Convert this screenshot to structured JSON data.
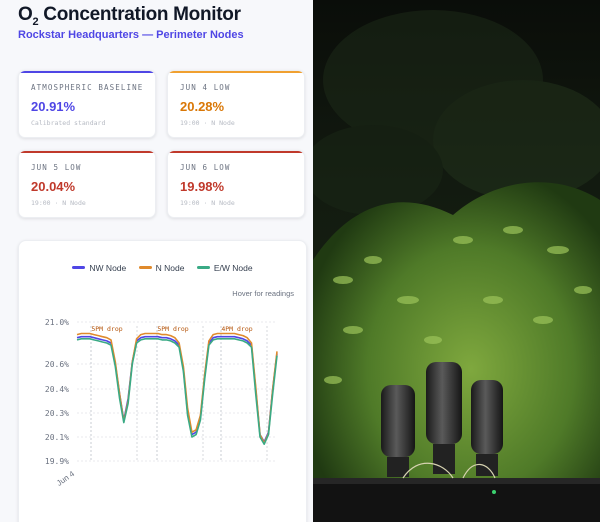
{
  "header": {
    "title_prefix": "O",
    "title_sub": "2",
    "title_rest": "Concentration Monitor",
    "subtitle": "Rockstar Headquarters — Perimeter Nodes"
  },
  "cards": [
    {
      "label": "ATMOSPHERIC BASELINE",
      "value": "20.91%",
      "note": "Calibrated standard",
      "color": "#4f46e5"
    },
    {
      "label": "JUN 4 LOW",
      "value": "20.28%",
      "note": "19:00 · N Node",
      "color": "#d97706"
    },
    {
      "label": "JUN 5 LOW",
      "value": "20.04%",
      "note": "19:00 · N Node",
      "color": "#c0392b"
    },
    {
      "label": "JUN 6 LOW",
      "value": "19.98%",
      "note": "19:00 · N Node",
      "color": "#c0392b"
    }
  ],
  "chart": {
    "hint": "Hover for readings"
  },
  "chart_data": {
    "type": "line",
    "ylim": [
      19.9,
      21.0
    ],
    "yticks": [
      "21.0%",
      "20.6%",
      "20.4%",
      "20.3%",
      "20.1%",
      "19.9%"
    ],
    "x_label_first": "Jun 4",
    "annotations": [
      "5PM drop",
      "5PM drop",
      "4PM drop"
    ],
    "legend_position": "top",
    "series": [
      {
        "name": "NW Node",
        "color": "#4f46e5",
        "values": [
          20.85,
          20.86,
          20.86,
          20.86,
          20.85,
          20.84,
          20.83,
          20.82,
          20.8,
          20.6,
          20.38,
          20.24,
          20.36,
          20.62,
          20.82,
          20.85,
          20.86,
          20.86,
          20.86,
          20.86,
          20.85,
          20.85,
          20.84,
          20.82,
          20.78,
          20.56,
          20.3,
          20.12,
          20.14,
          20.26,
          20.5,
          20.8,
          20.85,
          20.86,
          20.86,
          20.86,
          20.86,
          20.86,
          20.85,
          20.84,
          20.82,
          20.78,
          20.4,
          20.12,
          20.06,
          20.14,
          20.4,
          20.7
        ]
      },
      {
        "name": "N Node",
        "color": "#e08a2c",
        "values": [
          20.88,
          20.89,
          20.89,
          20.89,
          20.88,
          20.87,
          20.86,
          20.85,
          20.83,
          20.62,
          20.38,
          20.23,
          20.35,
          20.62,
          20.84,
          20.88,
          20.89,
          20.89,
          20.89,
          20.89,
          20.88,
          20.88,
          20.87,
          20.85,
          20.8,
          20.58,
          20.32,
          20.14,
          20.16,
          20.28,
          20.52,
          20.82,
          20.88,
          20.89,
          20.89,
          20.89,
          20.89,
          20.89,
          20.88,
          20.87,
          20.85,
          20.8,
          20.42,
          20.12,
          20.05,
          20.13,
          20.4,
          20.72
        ]
      },
      {
        "name": "E/W Node",
        "color": "#3aaa85",
        "values": [
          20.83,
          20.84,
          20.84,
          20.84,
          20.83,
          20.82,
          20.81,
          20.8,
          20.78,
          20.58,
          20.36,
          20.22,
          20.34,
          20.6,
          20.8,
          20.83,
          20.84,
          20.84,
          20.84,
          20.84,
          20.83,
          20.83,
          20.82,
          20.8,
          20.76,
          20.54,
          20.28,
          20.1,
          20.12,
          20.24,
          20.48,
          20.78,
          20.83,
          20.84,
          20.84,
          20.84,
          20.84,
          20.84,
          20.83,
          20.82,
          20.8,
          20.76,
          20.38,
          20.1,
          20.04,
          20.12,
          20.38,
          20.68
        ]
      }
    ]
  }
}
